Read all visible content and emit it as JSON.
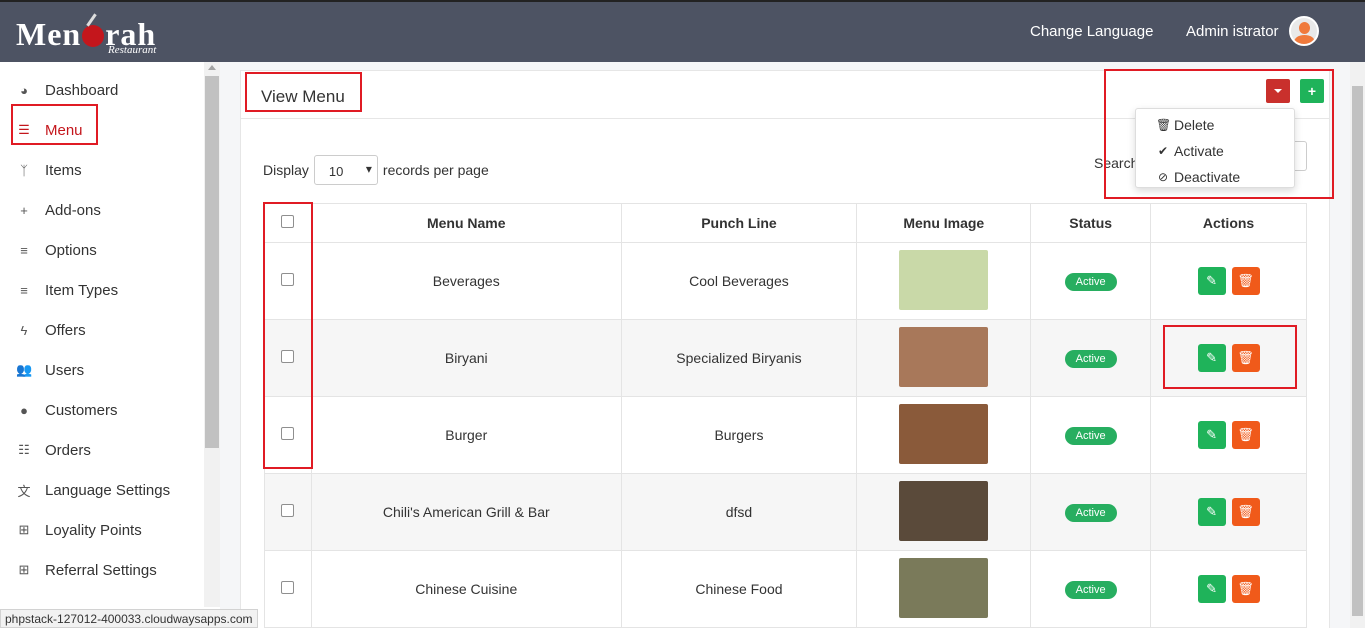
{
  "header": {
    "logo_text_left": "Men",
    "logo_text_right": "rah",
    "logo_sub": "Restaurant",
    "change_language": "Change Language",
    "admin_name": "Admin istrator"
  },
  "sidebar": {
    "items": [
      {
        "label": "Dashboard",
        "icon": "dashboard-icon",
        "glyph": "◕"
      },
      {
        "label": "Menu",
        "icon": "bars-icon",
        "glyph": "☰"
      },
      {
        "label": "Items",
        "icon": "cutlery-icon",
        "glyph": "ᛉ"
      },
      {
        "label": "Add-ons",
        "icon": "plus-icon",
        "glyph": "+"
      },
      {
        "label": "Options",
        "icon": "list-icon",
        "glyph": "≡"
      },
      {
        "label": "Item Types",
        "icon": "list-icon",
        "glyph": "≡"
      },
      {
        "label": "Offers",
        "icon": "bolt-icon",
        "glyph": "ϟ"
      },
      {
        "label": "Users",
        "icon": "users-icon",
        "glyph": "👥"
      },
      {
        "label": "Customers",
        "icon": "user-icon",
        "glyph": "●"
      },
      {
        "label": "Orders",
        "icon": "list-ul-icon",
        "glyph": "☷"
      },
      {
        "label": "Language Settings",
        "icon": "language-icon",
        "glyph": "文"
      },
      {
        "label": "Loyality Points",
        "icon": "gift-icon",
        "glyph": "⊞"
      },
      {
        "label": "Referral Settings",
        "icon": "gift-icon",
        "glyph": "⊞"
      }
    ]
  },
  "panel": {
    "title": "View Menu",
    "add_glyph": "+",
    "dropdown": [
      {
        "label": "Delete",
        "icon": "trash-icon",
        "glyph": "🗑"
      },
      {
        "label": "Activate",
        "icon": "check-icon",
        "glyph": "✔"
      },
      {
        "label": "Deactivate",
        "icon": "ban-icon",
        "glyph": "⊘"
      }
    ],
    "display_label": "Display",
    "per_page_value": "10",
    "per_page_suffix": "records per page",
    "search_label": "Search"
  },
  "table": {
    "headers": [
      "Menu Name",
      "Punch Line",
      "Menu Image",
      "Status",
      "Actions"
    ],
    "rows": [
      {
        "name": "Beverages",
        "punch": "Cool Beverages",
        "status": "Active",
        "image_color": "#c9d9a8"
      },
      {
        "name": "Biryani",
        "punch": "Specialized Biryanis",
        "status": "Active",
        "image_color": "#a8785a"
      },
      {
        "name": "Burger",
        "punch": "Burgers",
        "status": "Active",
        "image_color": "#8a5a3a"
      },
      {
        "name": "Chili's American Grill & Bar",
        "punch": "dfsd",
        "status": "Active",
        "image_color": "#5a4a3a"
      },
      {
        "name": "Chinese Cuisine",
        "punch": "Chinese Food",
        "status": "Active",
        "image_color": "#7a7a5a"
      }
    ],
    "edit_glyph": "✎",
    "delete_glyph": "🗑"
  },
  "statusbar": {
    "url": "phpstack-127012-400033.cloudwaysapps.com"
  },
  "colors": {
    "topbar": "#4d5363",
    "accent_red": "#c4161c",
    "green": "#1fb35a",
    "orange": "#f05a1a",
    "badge_green": "#27ae60",
    "highlight": "#e01b24"
  }
}
